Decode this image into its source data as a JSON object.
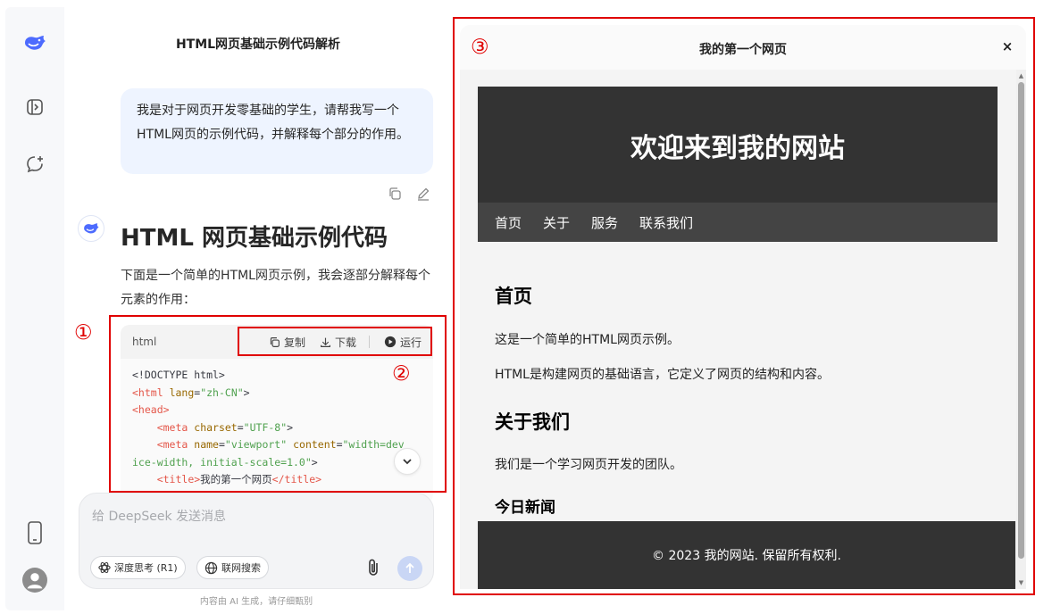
{
  "sidebar": {
    "icons": [
      "deepseek-logo",
      "sidebar-toggle-icon",
      "new-chat-icon",
      "phone-icon",
      "user-avatar"
    ]
  },
  "chat": {
    "title": "HTML网页基础示例代码解析",
    "user_message": "我是对于网页开发零基础的学生，请帮我写一个HTML网页的示例代码，并解释每个部分的作用。",
    "ai_heading": "HTML 网页基础示例代码",
    "ai_intro": "下面是一个简单的HTML网页示例，我会逐部分解释每个元素的作用：",
    "code": {
      "lang": "html",
      "copy_label": "复制",
      "download_label": "下载",
      "run_label": "运行"
    },
    "input": {
      "placeholder": "给 DeepSeek 发送消息",
      "deep_think_label": "深度思考 (R1)",
      "web_search_label": "联网搜索"
    },
    "disclaimer": "内容由 AI 生成，请仔细甄别"
  },
  "annotations": {
    "marker_1": "①",
    "marker_2": "②",
    "marker_3": "③"
  },
  "preview": {
    "title": "我的第一个网页",
    "close_glyph": "×",
    "site": {
      "h1": "欢迎来到我的网站",
      "nav": [
        "首页",
        "关于",
        "服务",
        "联系我们"
      ],
      "sections": {
        "home_title": "首页",
        "home_p1": "这是一个简单的HTML网页示例。",
        "home_p2": "HTML是构建网页的基础语言，它定义了网页的结构和内容。",
        "about_title": "关于我们",
        "about_p1": "我们是一个学习网页开发的团队。",
        "news_title": "今日新闻"
      },
      "footer": "© 2023 我的网站. 保留所有权利."
    }
  },
  "colors": {
    "accent": "#4d6bfe",
    "annotation_red": "#e00000",
    "site_dark": "#333333",
    "site_nav": "#444444"
  }
}
